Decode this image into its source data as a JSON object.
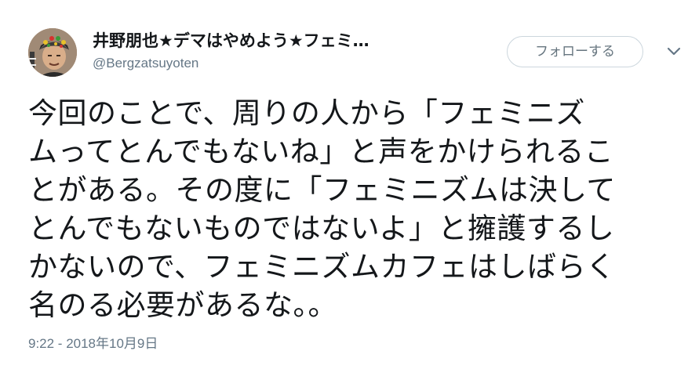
{
  "author": {
    "display_name": "井野朋也★デマはやめよう★フェミ…",
    "handle": "@Bergzatsuyoten",
    "avatar_icon": "user-avatar"
  },
  "actions": {
    "follow_label": "フォローする",
    "menu_icon": "chevron-down-icon"
  },
  "tweet": {
    "lines": [
      "今回のことで、周りの人から「フェミニズ",
      "ムってとんでもないね」と声をかけられるこ",
      "とがある。その度に「フェミニズムは決して",
      "とんでもないものではないよ」と擁護するし",
      "かないので、フェミニズムカフェはしばらく",
      "名のる必要があるな。。"
    ],
    "timestamp": "9:22 - 2018年10月9日"
  },
  "colors": {
    "text": "#14171a",
    "secondary": "#657786",
    "border": "#ccd6dd"
  }
}
